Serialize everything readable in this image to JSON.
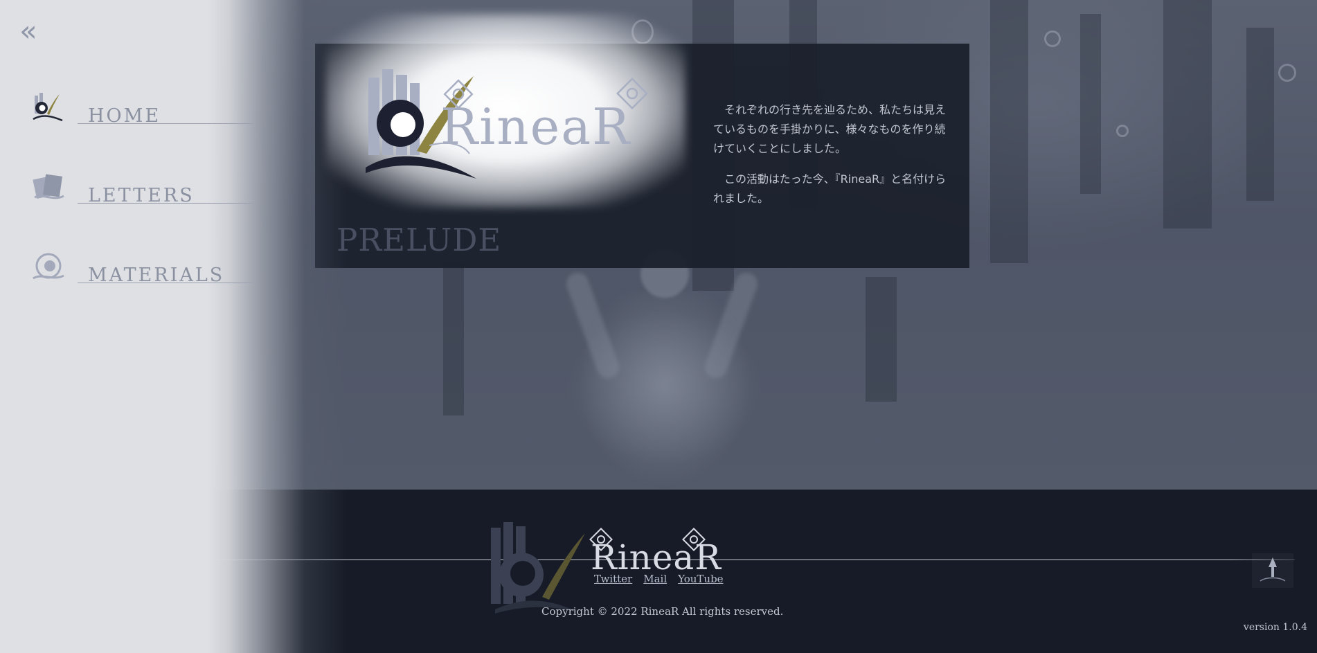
{
  "sidebar": {
    "collapse_icon": "double-chevron-left-icon",
    "items": [
      {
        "label": "HOME",
        "icon": "home-logo-icon"
      },
      {
        "label": "LETTERS",
        "icon": "letters-icon"
      },
      {
        "label": "MATERIALS",
        "icon": "materials-icon"
      }
    ]
  },
  "hero": {
    "logo_text": "RineaR",
    "section_title": "PRELUDE",
    "intro_paragraphs": [
      "それぞれの行き先を辿るため、私たちは見えているものを手掛かりに、様々なものを作り続けていくことにしました。",
      "この活動はたった今、『RineaR』と名付けられました。"
    ]
  },
  "footer": {
    "logo_text": "RineaR",
    "links": [
      "Twitter",
      "Mail",
      "YouTube"
    ],
    "copyright": "Copyright © 2022 RineaR All rights reserved.",
    "version": "version 1.0.4",
    "to_top_icon": "back-to-top-arrow-icon"
  },
  "colors": {
    "sidebar_bg": "#dee0e4",
    "panel_bg": "#1a1f2b",
    "footer_bg": "#161b27",
    "accent_gold": "#8d8442",
    "logo_blue_gray": "#a9afc3"
  }
}
